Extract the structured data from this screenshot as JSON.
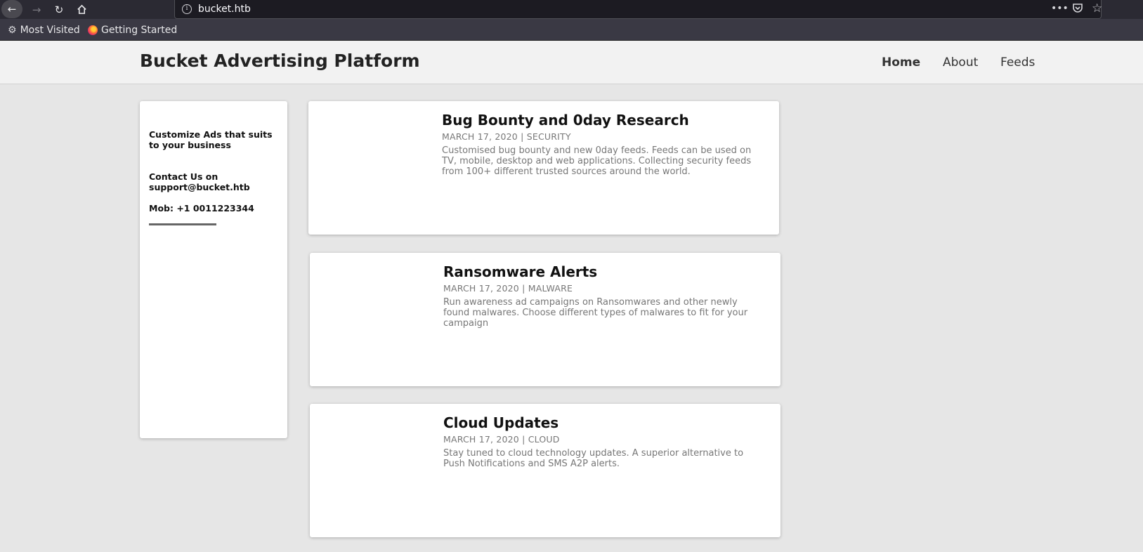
{
  "browser": {
    "url": "bucket.htb",
    "bookmarks": [
      "Most Visited",
      "Getting Started"
    ]
  },
  "header": {
    "title": "Bucket Advertising Platform",
    "nav": [
      "Home",
      "About",
      "Feeds"
    ]
  },
  "sidebar": {
    "tagline": "Customize Ads that suits to your business",
    "contact": "Contact Us on support@bucket.htb",
    "mobile": "Mob: +1 0011223344"
  },
  "cards": [
    {
      "title": "Bug Bounty and 0day Research",
      "meta": "MARCH 17, 2020 | SECURITY",
      "desc": "Customised bug bounty and new 0day feeds. Feeds can be used on TV, mobile, desktop and web applications. Collecting security feeds from 100+ different trusted sources around the world."
    },
    {
      "title": "Ransomware Alerts",
      "meta": "MARCH 17, 2020 | MALWARE",
      "desc": "Run awareness ad campaigns on Ransomwares and other newly found malwares. Choose different types of malwares to fit for your campaign"
    },
    {
      "title": "Cloud Updates",
      "meta": "MARCH 17, 2020 | CLOUD",
      "desc": "Stay tuned to cloud technology updates. A superior alternative to Push Notifications and SMS A2P alerts."
    }
  ]
}
